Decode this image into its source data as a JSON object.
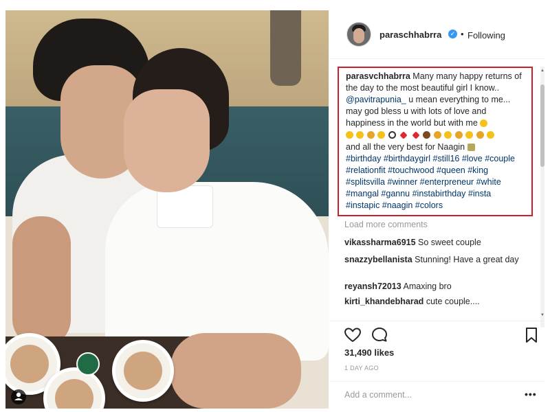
{
  "post": {
    "username": "paraschhabrra",
    "follow_status": "Following",
    "separator": "•",
    "caption": {
      "username": "parasvchhabrra",
      "text_1": "Many many happy returns of the day to the most beautiful girl I know..",
      "mention": "@pavitrapunia_",
      "text_2": "u mean everything to me... may god bless u with lots of love and happiness in the world but with me",
      "text_3": "and all the very best for Naagin",
      "hashtags": "#birthday #birthdaygirl #still16 #love #couple #relationfit #touchwood #queen #king #splitsvilla #winner #enterpreneur #white #mangal #gannu #instabirthday #insta #instapic #naagin #colors"
    },
    "load_more": "Load more comments",
    "comments": [
      {
        "user": "vikassharma6915",
        "text": "So sweet couple"
      },
      {
        "user": "snazzybellanista",
        "text": "Stunning! Have a great day"
      },
      {
        "user": "reyansh72013",
        "text": "Amaxing bro"
      },
      {
        "user": "kirti_khandebharad",
        "text": "cute couple...."
      }
    ],
    "likes": "31,490 likes",
    "date": "1 DAY AGO",
    "comment_placeholder": "Add a comment...",
    "more_options": "•••"
  },
  "icons": {
    "like": "heart-icon",
    "comment": "comment-icon",
    "save": "bookmark-icon",
    "verified": "verified-badge-icon",
    "user_tag": "user-tag-icon"
  },
  "colors": {
    "highlight_border": "#c8202c",
    "link": "#003569",
    "verified": "#3897f0",
    "muted": "#999999"
  }
}
